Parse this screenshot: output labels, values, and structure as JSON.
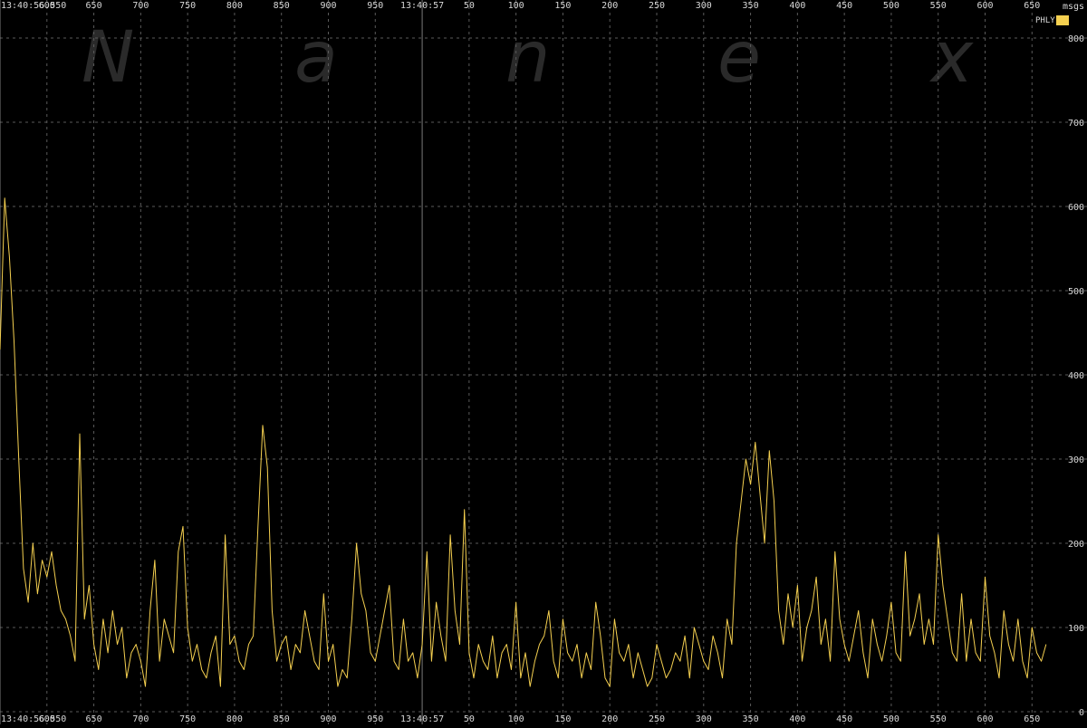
{
  "watermark": [
    "N",
    "a",
    "n",
    "e",
    "x"
  ],
  "chart_data": {
    "type": "line",
    "unit_label": "msgs",
    "ylim": [
      0,
      800
    ],
    "yticks": [
      0,
      100,
      200,
      300,
      400,
      500,
      600,
      700,
      800
    ],
    "grid": true,
    "grid_style": "dashed",
    "legend_placement": "top-right",
    "x_axis_labels": [
      "13:40:56.550",
      "600",
      "650",
      "700",
      "750",
      "800",
      "850",
      "900",
      "950",
      "13:40:57",
      "50",
      "100",
      "150",
      "200",
      "250",
      "300",
      "350",
      "400",
      "450",
      "500",
      "550",
      "600",
      "650"
    ],
    "x_axis_ms": [
      550,
      600,
      650,
      700,
      750,
      800,
      850,
      900,
      950,
      1000,
      1050,
      1100,
      1150,
      1200,
      1250,
      1300,
      1350,
      1400,
      1450,
      1500,
      1550,
      1600,
      1650
    ],
    "x_start_ms": 550,
    "x_end_ms": 1670,
    "series": [
      {
        "name": "PHLY",
        "color": "#f5d050",
        "x_ms": [
          550,
          555,
          560,
          565,
          570,
          575,
          580,
          585,
          590,
          595,
          600,
          605,
          610,
          615,
          620,
          625,
          630,
          635,
          640,
          645,
          650,
          655,
          660,
          665,
          670,
          675,
          680,
          685,
          690,
          695,
          700,
          705,
          710,
          715,
          720,
          725,
          730,
          735,
          740,
          745,
          750,
          755,
          760,
          765,
          770,
          775,
          780,
          785,
          790,
          795,
          800,
          805,
          810,
          815,
          820,
          825,
          830,
          835,
          840,
          845,
          850,
          855,
          860,
          865,
          870,
          875,
          880,
          885,
          890,
          895,
          900,
          905,
          910,
          915,
          920,
          925,
          930,
          935,
          940,
          945,
          950,
          955,
          960,
          965,
          970,
          975,
          980,
          985,
          990,
          995,
          1000,
          1005,
          1010,
          1015,
          1020,
          1025,
          1030,
          1035,
          1040,
          1045,
          1050,
          1055,
          1060,
          1065,
          1070,
          1075,
          1080,
          1085,
          1090,
          1095,
          1100,
          1105,
          1110,
          1115,
          1120,
          1125,
          1130,
          1135,
          1140,
          1145,
          1150,
          1155,
          1160,
          1165,
          1170,
          1175,
          1180,
          1185,
          1190,
          1195,
          1200,
          1205,
          1210,
          1215,
          1220,
          1225,
          1230,
          1235,
          1240,
          1245,
          1250,
          1255,
          1260,
          1265,
          1270,
          1275,
          1280,
          1285,
          1290,
          1295,
          1300,
          1305,
          1310,
          1315,
          1320,
          1325,
          1330,
          1335,
          1340,
          1345,
          1350,
          1355,
          1360,
          1365,
          1370,
          1375,
          1380,
          1385,
          1390,
          1395,
          1400,
          1405,
          1410,
          1415,
          1420,
          1425,
          1430,
          1435,
          1440,
          1445,
          1450,
          1455,
          1460,
          1465,
          1470,
          1475,
          1480,
          1485,
          1490,
          1495,
          1500,
          1505,
          1510,
          1515,
          1520,
          1525,
          1530,
          1535,
          1540,
          1545,
          1550,
          1555,
          1560,
          1565,
          1570,
          1575,
          1580,
          1585,
          1590,
          1595,
          1600,
          1605,
          1610,
          1615,
          1620,
          1625,
          1630,
          1635,
          1640,
          1645,
          1650,
          1655,
          1660,
          1665
        ],
        "values": [
          430,
          610,
          540,
          440,
          300,
          170,
          130,
          200,
          140,
          180,
          160,
          190,
          150,
          120,
          110,
          90,
          60,
          330,
          110,
          150,
          80,
          50,
          110,
          70,
          120,
          80,
          100,
          40,
          70,
          80,
          60,
          30,
          120,
          180,
          60,
          110,
          90,
          70,
          190,
          220,
          100,
          60,
          80,
          50,
          40,
          70,
          90,
          30,
          210,
          80,
          90,
          60,
          50,
          80,
          90,
          220,
          340,
          290,
          120,
          60,
          80,
          90,
          50,
          80,
          70,
          120,
          90,
          60,
          50,
          140,
          60,
          80,
          30,
          50,
          40,
          110,
          200,
          140,
          120,
          70,
          60,
          90,
          120,
          150,
          60,
          50,
          110,
          60,
          70,
          40,
          80,
          190,
          60,
          130,
          90,
          60,
          210,
          120,
          80,
          240,
          70,
          40,
          80,
          60,
          50,
          90,
          40,
          70,
          80,
          50,
          130,
          40,
          70,
          30,
          60,
          80,
          90,
          120,
          60,
          40,
          110,
          70,
          60,
          80,
          40,
          70,
          50,
          130,
          90,
          40,
          30,
          110,
          70,
          60,
          80,
          40,
          70,
          50,
          30,
          40,
          80,
          60,
          40,
          50,
          70,
          60,
          90,
          40,
          100,
          80,
          60,
          50,
          90,
          70,
          40,
          110,
          80,
          200,
          250,
          300,
          270,
          320,
          260,
          200,
          310,
          250,
          120,
          80,
          140,
          100,
          150,
          60,
          100,
          120,
          160,
          80,
          110,
          60,
          190,
          110,
          80,
          60,
          90,
          120,
          70,
          40,
          110,
          80,
          60,
          90,
          130,
          70,
          60,
          190,
          90,
          110,
          140,
          80,
          110,
          80,
          210,
          150,
          110,
          70,
          60,
          140,
          60,
          110,
          70,
          60,
          160,
          90,
          70,
          40,
          120,
          80,
          60,
          110,
          60,
          40,
          100,
          70,
          60,
          80,
          50,
          60,
          40,
          90
        ]
      }
    ]
  }
}
